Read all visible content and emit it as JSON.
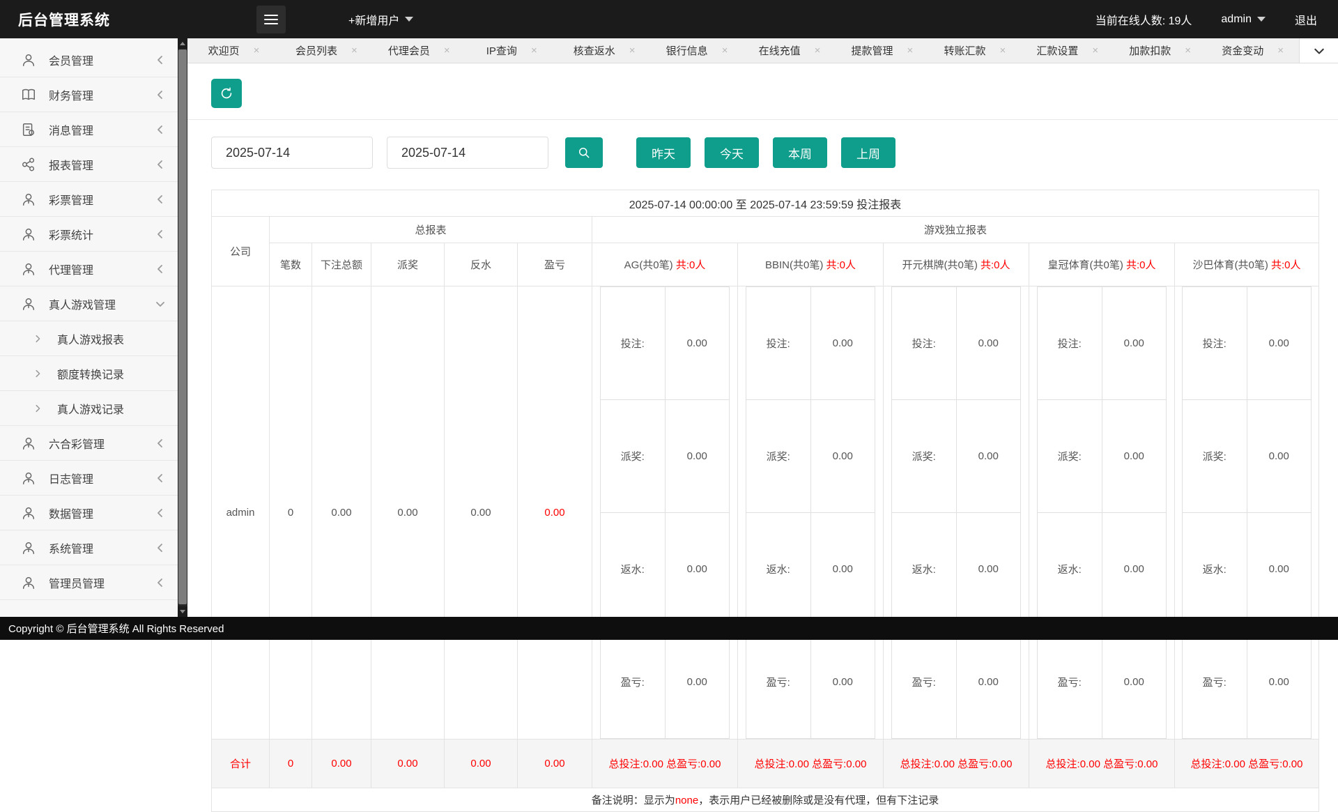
{
  "colors": {
    "accent_teal": "#0f9d8c",
    "alert_red": "#ff0000",
    "topbar_bg": "#1b1b1b"
  },
  "topbar": {
    "title": "后台管理系统",
    "new_user": "+新增用户",
    "online": "当前在线人数: 19人",
    "user": "admin",
    "logout": "退出",
    "icons": [
      "hamburger-icon",
      "caret-down-icon"
    ]
  },
  "sidebar": {
    "items": [
      {
        "label": "会员管理",
        "icon": "user-icon",
        "chevron": "left"
      },
      {
        "label": "财务管理",
        "icon": "book-icon",
        "chevron": "left"
      },
      {
        "label": "消息管理",
        "icon": "file-icon",
        "chevron": "left"
      },
      {
        "label": "报表管理",
        "icon": "share-icon",
        "chevron": "left"
      },
      {
        "label": "彩票管理",
        "icon": "user-icon",
        "chevron": "left"
      },
      {
        "label": "彩票统计",
        "icon": "user-icon",
        "chevron": "left"
      },
      {
        "label": "代理管理",
        "icon": "user-icon",
        "chevron": "left"
      },
      {
        "label": "真人游戏管理",
        "icon": "user-icon",
        "chevron": "down",
        "expanded": true
      },
      {
        "label": "真人游戏报表",
        "icon": "chevron-right-icon",
        "child": true
      },
      {
        "label": "额度转换记录",
        "icon": "chevron-right-icon",
        "child": true
      },
      {
        "label": "真人游戏记录",
        "icon": "chevron-right-icon",
        "child": true
      },
      {
        "label": "六合彩管理",
        "icon": "user-icon",
        "chevron": "left"
      },
      {
        "label": "日志管理",
        "icon": "user-icon",
        "chevron": "left"
      },
      {
        "label": "数据管理",
        "icon": "user-icon",
        "chevron": "left"
      },
      {
        "label": "系统管理",
        "icon": "user-icon",
        "chevron": "left"
      },
      {
        "label": "管理员管理",
        "icon": "user-icon",
        "chevron": "left"
      }
    ]
  },
  "tabs": [
    {
      "label": "欢迎页"
    },
    {
      "label": "会员列表"
    },
    {
      "label": "代理会员"
    },
    {
      "label": "IP查询"
    },
    {
      "label": "核查返水"
    },
    {
      "label": "银行信息"
    },
    {
      "label": "在线充值"
    },
    {
      "label": "提款管理"
    },
    {
      "label": "转账汇款"
    },
    {
      "label": "汇款设置"
    },
    {
      "label": "加款扣款"
    },
    {
      "label": "资金变动"
    }
  ],
  "tab_close": "×",
  "filters": {
    "date_from": "2025-07-14",
    "date_to": "2025-07-14",
    "search_icon": "magnifier-icon",
    "refresh_icon": "refresh-icon",
    "quick": [
      {
        "label": "昨天"
      },
      {
        "label": "今天"
      },
      {
        "label": "本周"
      },
      {
        "label": "上周"
      }
    ]
  },
  "report": {
    "title": "2025-07-14 00:00:00 至 2025-07-14 23:59:59 投注报表",
    "company_header": "公司",
    "total_group": "总报表",
    "games_group": "游戏独立报表",
    "total_columns": [
      "笔数",
      "下注总额",
      "派奖",
      "反水",
      "盈亏"
    ],
    "stat_labels": [
      "投注:",
      "派奖:",
      "返水:",
      "盈亏:"
    ],
    "games": [
      {
        "name": "AG(共0笔)",
        "count": "共:0人",
        "stats": [
          "0.00",
          "0.00",
          "0.00",
          "0.00"
        ],
        "summary": "总投注:0.00 总盈亏:0.00"
      },
      {
        "name": "BBIN(共0笔)",
        "count": "共:0人",
        "stats": [
          "0.00",
          "0.00",
          "0.00",
          "0.00"
        ],
        "summary": "总投注:0.00 总盈亏:0.00"
      },
      {
        "name": "开元棋牌(共0笔)",
        "count": "共:0人",
        "stats": [
          "0.00",
          "0.00",
          "0.00",
          "0.00"
        ],
        "summary": "总投注:0.00 总盈亏:0.00"
      },
      {
        "name": "皇冠体育(共0笔)",
        "count": "共:0人",
        "stats": [
          "0.00",
          "0.00",
          "0.00",
          "0.00"
        ],
        "summary": "总投注:0.00 总盈亏:0.00"
      },
      {
        "name": "沙巴体育(共0笔)",
        "count": "共:0人",
        "stats": [
          "0.00",
          "0.00",
          "0.00",
          "0.00"
        ],
        "summary": "总投注:0.00 总盈亏:0.00"
      }
    ],
    "rows": [
      {
        "company": "admin",
        "values": [
          "0",
          "0.00",
          "0.00",
          "0.00",
          "0.00"
        ]
      }
    ],
    "summary": {
      "label": "合计",
      "values": [
        "0",
        "0.00",
        "0.00",
        "0.00",
        "0.00"
      ]
    },
    "note": {
      "prefix": "备注说明：显示为",
      "highlight": "none",
      "suffix": "，表示用户已经被删除或是没有代理，但有下注记录"
    }
  },
  "footer": {
    "copyright": "Copyright © 后台管理系统 All Rights Reserved"
  }
}
